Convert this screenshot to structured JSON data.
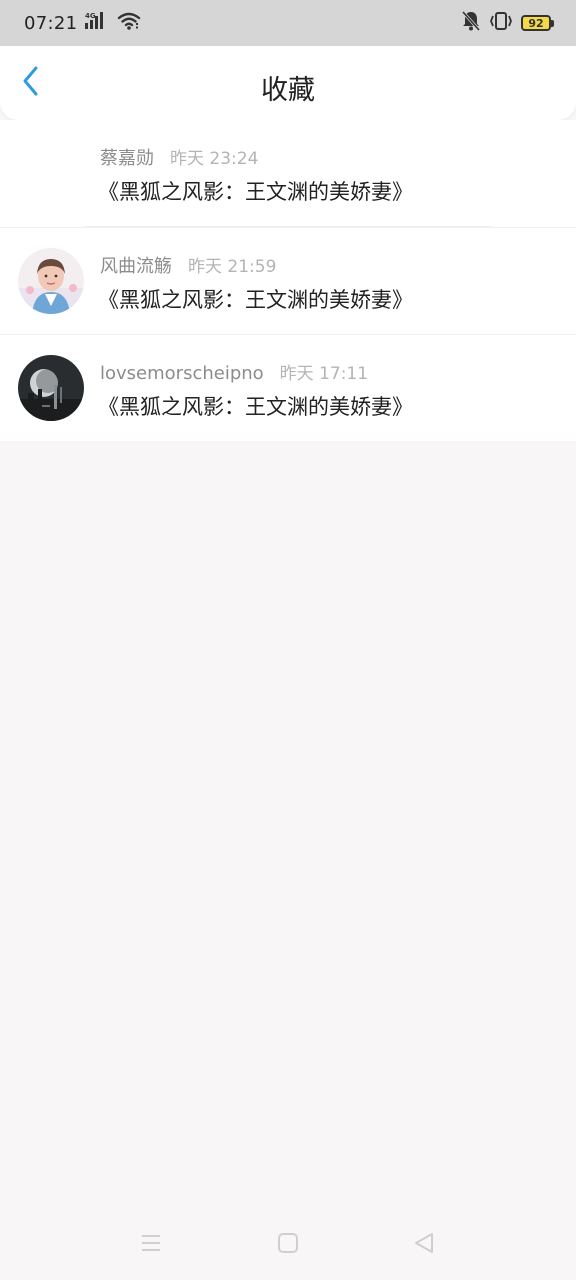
{
  "status_bar": {
    "time": "07:21",
    "network_label": "4G",
    "battery": "92",
    "icons": [
      "signal-icon",
      "wifi-icon",
      "bell-muted-icon",
      "vibrate-icon",
      "battery-icon"
    ]
  },
  "header": {
    "title": "收藏",
    "back_icon": "chevron-left-icon",
    "accent": "#2f9be0"
  },
  "favorites": [
    {
      "author": "蔡嘉勋",
      "time": "昨天 23:24",
      "title": "《黑狐之风影：王文渊的美娇妻》",
      "avatar": "none"
    },
    {
      "author": "风曲流觞",
      "time": "昨天 21:59",
      "title": "《黑狐之风影：王文渊的美娇妻》",
      "avatar": "photo-person"
    },
    {
      "author": "lovsemorscheipno",
      "time": "昨天 17:11",
      "title": "《黑狐之风影：王文渊的美娇妻》",
      "avatar": "photo-dark-moon"
    }
  ],
  "nav_bar": {
    "icons": [
      "menu-icon",
      "home-square-icon",
      "back-triangle-icon"
    ]
  }
}
